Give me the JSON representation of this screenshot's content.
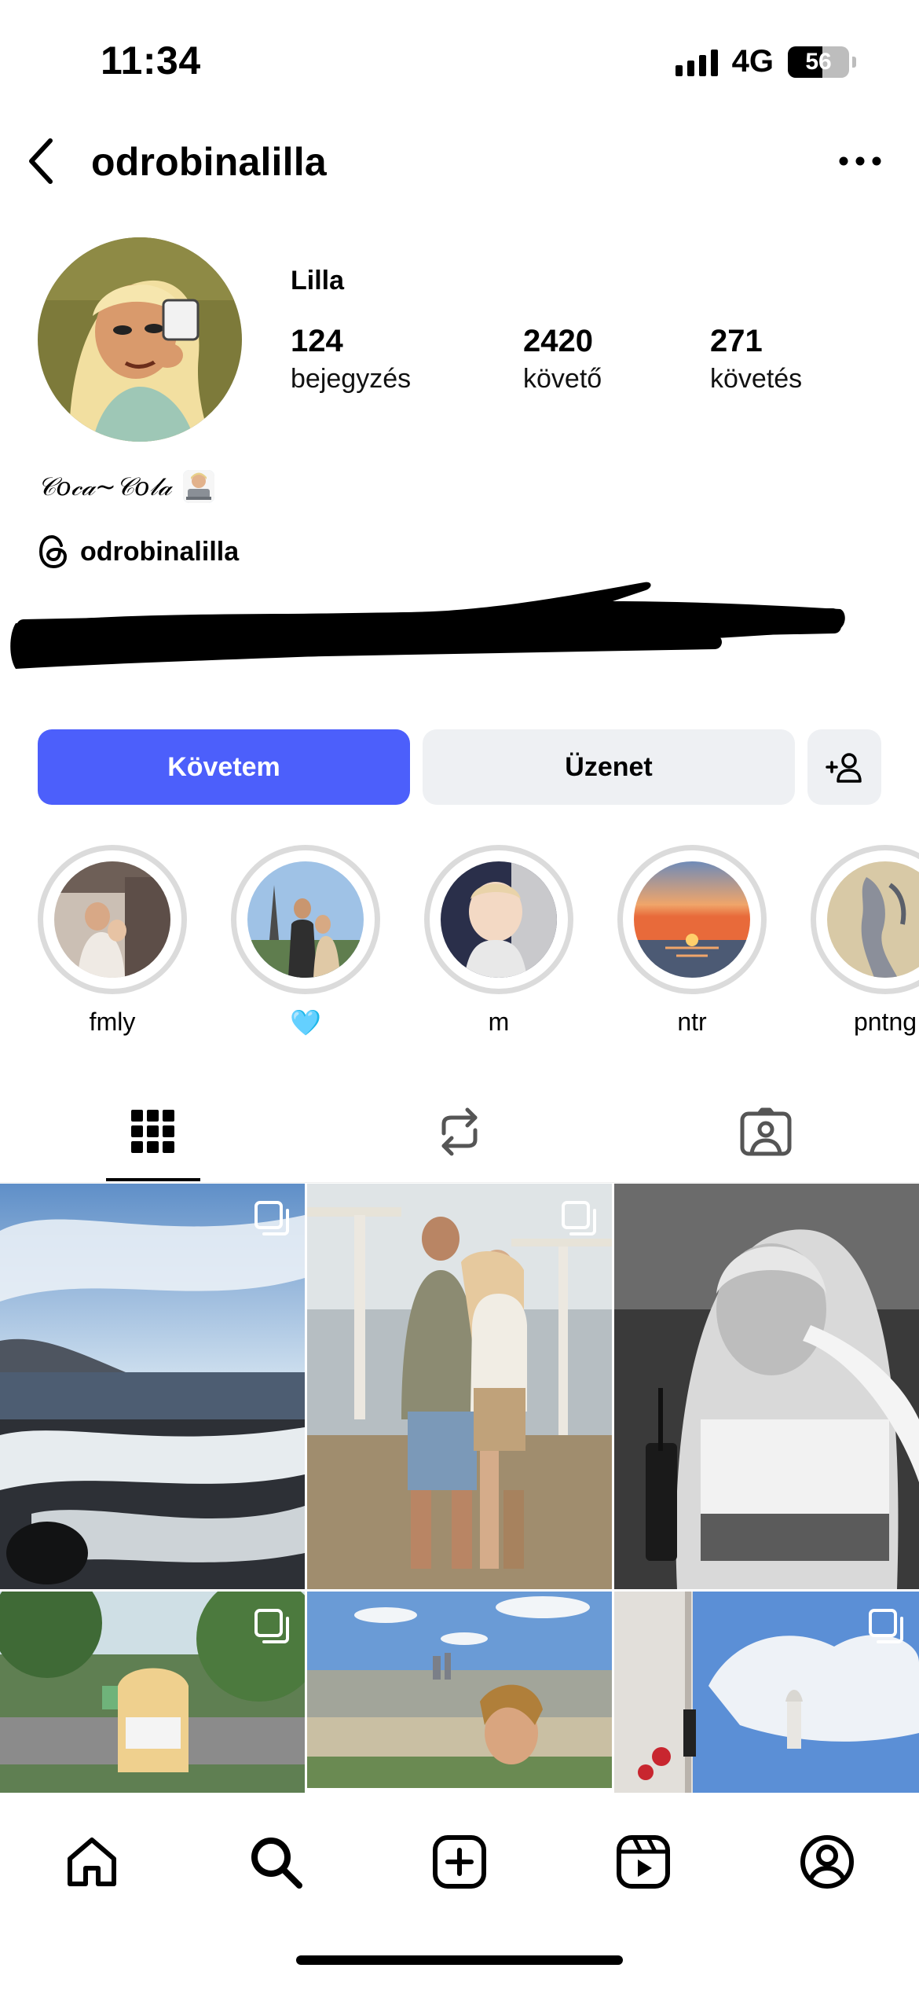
{
  "status_bar": {
    "time": "11:34",
    "network": "4G",
    "battery": "56",
    "battery_fraction": 0.56
  },
  "header": {
    "username": "odrobinalilla"
  },
  "profile": {
    "name": "Lilla",
    "stats": [
      {
        "value": "124",
        "label": "bejegyzés"
      },
      {
        "value": "2420",
        "label": "követő"
      },
      {
        "value": "271",
        "label": "követés"
      }
    ],
    "bio": "𝒞𝑜𝒸𝒶~𝒞𝑜𝓁𝒶",
    "threads_handle": "odrobinalilla"
  },
  "buttons": {
    "follow": "Követem",
    "message": "Üzenet"
  },
  "highlights": [
    {
      "label": "fmly"
    },
    {
      "label": "🩵"
    },
    {
      "label": "m"
    },
    {
      "label": "ntr"
    },
    {
      "label": "pntng"
    }
  ],
  "tabs": [
    "grid-tab",
    "reels-tab",
    "tagged-tab"
  ],
  "icons": {
    "back": "chevron-left-icon",
    "more": "more-dots-icon",
    "add_user": "add-user-icon",
    "threads": "threads-icon",
    "nav": [
      "home-icon",
      "search-icon",
      "create-icon",
      "reels-icon",
      "profile-icon"
    ]
  },
  "colors": {
    "follow_button": "#4c5ffb",
    "secondary_button": "#eef0f3",
    "ring": "#dbdbdb"
  }
}
